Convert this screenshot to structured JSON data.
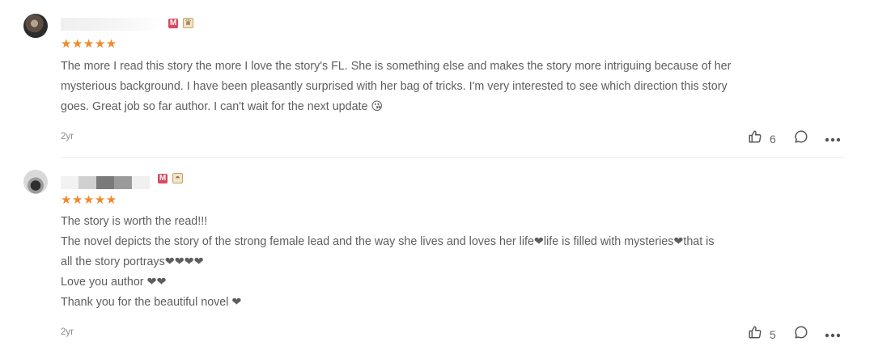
{
  "reviews": [
    {
      "stars": "★★★★★",
      "badge_icons": [
        "vip-badge-icon",
        "crown-badge-icon"
      ],
      "lines": [
        "The more I read this story the more I love the story's FL. She is something else and makes the story more intriguing because of her",
        "mysterious background. I have been pleasantly surprised with her bag of tricks. I'm very interested to see which direction this story",
        "goes. Great job so far author. I can't wait for the next update 😘"
      ],
      "time": "2yr",
      "likes": "6"
    },
    {
      "stars": "★★★★★",
      "badge_icons": [
        "vip-badge-icon",
        "frame-badge-icon"
      ],
      "lines": [
        "The story is worth the read!!!",
        "The novel depicts the story of the strong female lead and the way she lives and loves her life❤life is filled with mysteries❤that is",
        "all the story portrays❤❤❤❤",
        "Love you author ❤❤",
        "Thank you for the beautiful novel ❤"
      ],
      "time": "2yr",
      "likes": "5"
    }
  ],
  "colors": {
    "star": "#f08a2b",
    "text": "#5e5e5e",
    "meta": "#8c8c8c",
    "divider": "#ececec"
  },
  "icons": {
    "like": "thumbs-up-icon",
    "comment": "comment-bubble-icon",
    "more": "more-dots-icon"
  }
}
